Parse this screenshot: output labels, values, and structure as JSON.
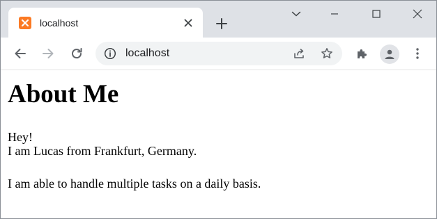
{
  "tab": {
    "title": "localhost",
    "favicon": "xampp-icon",
    "favicon_color": "#fb7a24"
  },
  "toolbar": {
    "url": "localhost"
  },
  "page": {
    "heading": "About Me",
    "greeting": "Hey!",
    "intro": "I am Lucas from Frankfurt, Germany.",
    "body": "I am able to handle multiple tasks on a daily basis."
  },
  "colors": {
    "tabstrip": "#dee1e6",
    "omnibox": "#f1f3f4",
    "icon": "#5f6368"
  }
}
